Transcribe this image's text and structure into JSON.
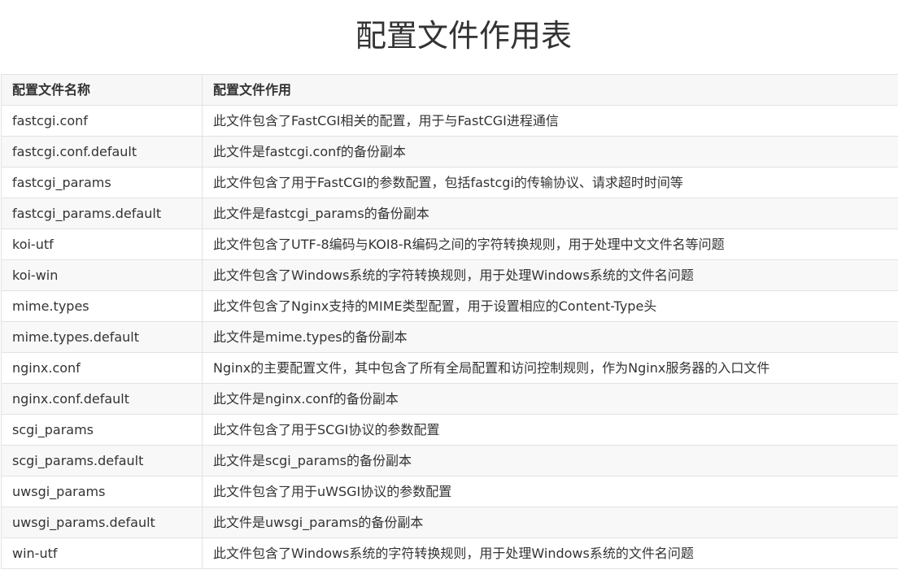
{
  "page": {
    "title": "配置文件作用表"
  },
  "table": {
    "headers": [
      "配置文件名称",
      "配置文件作用"
    ],
    "rows": [
      {
        "name": "fastcgi.conf",
        "description": "此文件包含了FastCGI相关的配置，用于与FastCGI进程通信"
      },
      {
        "name": "fastcgi.conf.default",
        "description": "此文件是fastcgi.conf的备份副本"
      },
      {
        "name": "fastcgi_params",
        "description": "此文件包含了用于FastCGI的参数配置，包括fastcgi的传输协议、请求超时时间等"
      },
      {
        "name": "fastcgi_params.default",
        "description": "此文件是fastcgi_params的备份副本"
      },
      {
        "name": "koi-utf",
        "description": "此文件包含了UTF-8编码与KOI8-R编码之间的字符转换规则，用于处理中文文件名等问题"
      },
      {
        "name": "koi-win",
        "description": "此文件包含了Windows系统的字符转换规则，用于处理Windows系统的文件名问题"
      },
      {
        "name": "mime.types",
        "description": "此文件包含了Nginx支持的MIME类型配置，用于设置相应的Content-Type头"
      },
      {
        "name": "mime.types.default",
        "description": "此文件是mime.types的备份副本"
      },
      {
        "name": "nginx.conf",
        "description": "Nginx的主要配置文件，其中包含了所有全局配置和访问控制规则，作为Nginx服务器的入口文件"
      },
      {
        "name": "nginx.conf.default",
        "description": "此文件是nginx.conf的备份副本"
      },
      {
        "name": "scgi_params",
        "description": "此文件包含了用于SCGI协议的参数配置"
      },
      {
        "name": "scgi_params.default",
        "description": "此文件是scgi_params的备份副本"
      },
      {
        "name": "uwsgi_params",
        "description": "此文件包含了用于uWSGI协议的参数配置"
      },
      {
        "name": "uwsgi_params.default",
        "description": "此文件是uwsgi_params的备份副本"
      },
      {
        "name": "win-utf",
        "description": "此文件包含了Windows系统的字符转换规则，用于处理Windows系统的文件名问题"
      }
    ]
  }
}
